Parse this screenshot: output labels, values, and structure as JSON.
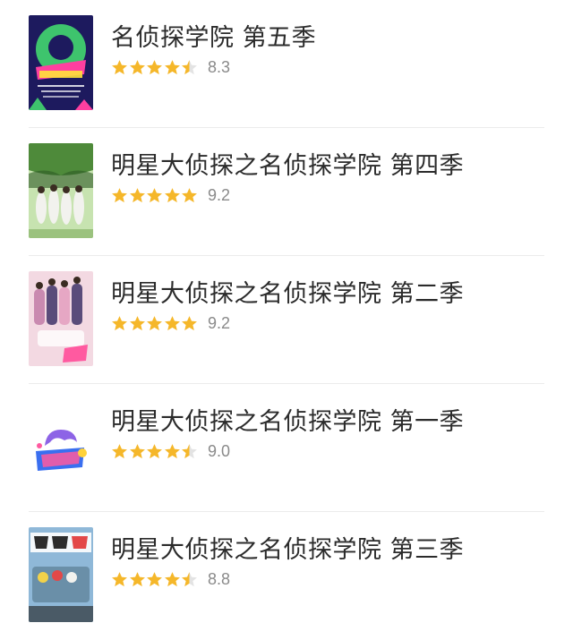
{
  "items": [
    {
      "title": "名侦探学院 第五季",
      "score": "8.3",
      "stars": [
        1,
        1,
        1,
        1,
        0.5
      ],
      "poster": {
        "name": "poster-season-5",
        "colors": [
          "#1d1a5e",
          "#3ec46d",
          "#ff3fa0",
          "#ffffff"
        ]
      }
    },
    {
      "title": "明星大侦探之名侦探学院 第四季",
      "score": "9.2",
      "stars": [
        1,
        1,
        1,
        1,
        1
      ],
      "poster": {
        "name": "poster-season-4",
        "colors": [
          "#4e8a3a",
          "#c7e3b0",
          "#f2f2ee",
          "#2d5a25"
        ]
      }
    },
    {
      "title": "明星大侦探之名侦探学院 第二季",
      "score": "9.2",
      "stars": [
        1,
        1,
        1,
        1,
        1
      ],
      "poster": {
        "name": "poster-season-2",
        "colors": [
          "#f3d9e2",
          "#c98ab0",
          "#5a4c7a",
          "#ffffff"
        ]
      }
    },
    {
      "title": "明星大侦探之名侦探学院 第一季",
      "score": "9.0",
      "stars": [
        1,
        1,
        1,
        1,
        0.5
      ],
      "poster": {
        "name": "poster-season-1-logo",
        "colors": [
          "#ffffff",
          "#3a6ff0",
          "#ff5aa0",
          "#8d63e6"
        ]
      }
    },
    {
      "title": "明星大侦探之名侦探学院 第三季",
      "score": "8.8",
      "stars": [
        1,
        1,
        1,
        1,
        0.5
      ],
      "poster": {
        "name": "poster-season-3",
        "colors": [
          "#8fb8d8",
          "#e34848",
          "#2c2c2c",
          "#f2d24a"
        ]
      }
    }
  ],
  "colors": {
    "star": "#f5b72a",
    "star_empty": "#e3e3e3",
    "title": "#2b2b2b",
    "score": "#8a8a8a",
    "divider": "#ececec"
  }
}
